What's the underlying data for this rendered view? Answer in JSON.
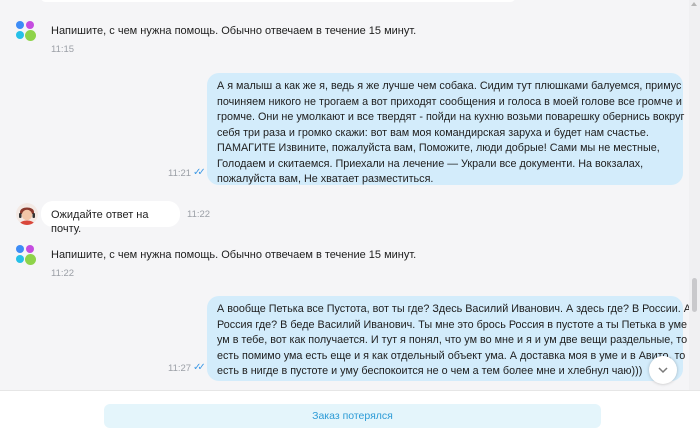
{
  "messages": [
    {
      "type": "bot",
      "text": "Напишите, с чем нужна помощь. Обычно отвечаем в течение 15 минут.",
      "time": "11:15"
    },
    {
      "type": "outgoing",
      "lines": [
        "А я малыш а как же я, ведь я же лучше чем собака. Сидим тут плюшками балуемся, примус",
        "починяем никого не трогаем а вот приходят сообщения и голоса в моей голове все громче и",
        "громче. Они не умолкают и все твердят - пойди на кухню возьми поварешку обернись вокруг",
        "себя три раза и громко скажи: вот вам моя командирская заруха и будет нам счастье.",
        "ПАМАГИТЕ Извините, пожалуйста вам, Поможите, люди добрые! Сами мы не местные,",
        "Голодаем и скитаемся. Приехали на лечение — Украли все документи. На вокзалах,",
        "пожалуйста вам, Не хватает разместиться."
      ],
      "time": "11:21",
      "status": "read"
    },
    {
      "type": "operator",
      "text": "Ожидайте ответ на почту.",
      "time": "11:22"
    },
    {
      "type": "bot",
      "text": "Напишите, с чем нужна помощь. Обычно отвечаем в течение 15 минут.",
      "time": "11:22"
    },
    {
      "type": "outgoing",
      "lines": [
        "А вообще Петька все Пустота, вот ты где? Здесь Василий Иванович. А здесь где? В России. А",
        "Россия где? В беде Василий Иванович. Ты мне это брось Россия в пустоте а ты Петька в уме а",
        "ум в тебе, вот как получается. И тут я понял, что ум во мне и я и ум две вещи раздельные, то",
        "есть помимо ума есть еще и я как отдельный объект ума. А доставка моя в уме и в Авито, то",
        "есть в нигде  в пустоте и уму беспокоится не о чем а тем более мне и хлебнул чаю)))"
      ],
      "time": "11:27",
      "status": "read"
    }
  ],
  "icons": {
    "read_status": "double-check-icon",
    "scroll_down": "chevron-down-icon",
    "bot_avatar": "four-dots-logo-icon",
    "operator_avatar": "operator-avatar-icon"
  },
  "colors": {
    "outgoing_bubble": "#d3ecfb",
    "incoming_bubble": "#ffffff",
    "background": "#f5f5f7",
    "accent": "#2c9bd6",
    "read_ticks": "#3f9ae6"
  },
  "footer": {
    "quick_reply_label": "Заказ потерялся"
  }
}
